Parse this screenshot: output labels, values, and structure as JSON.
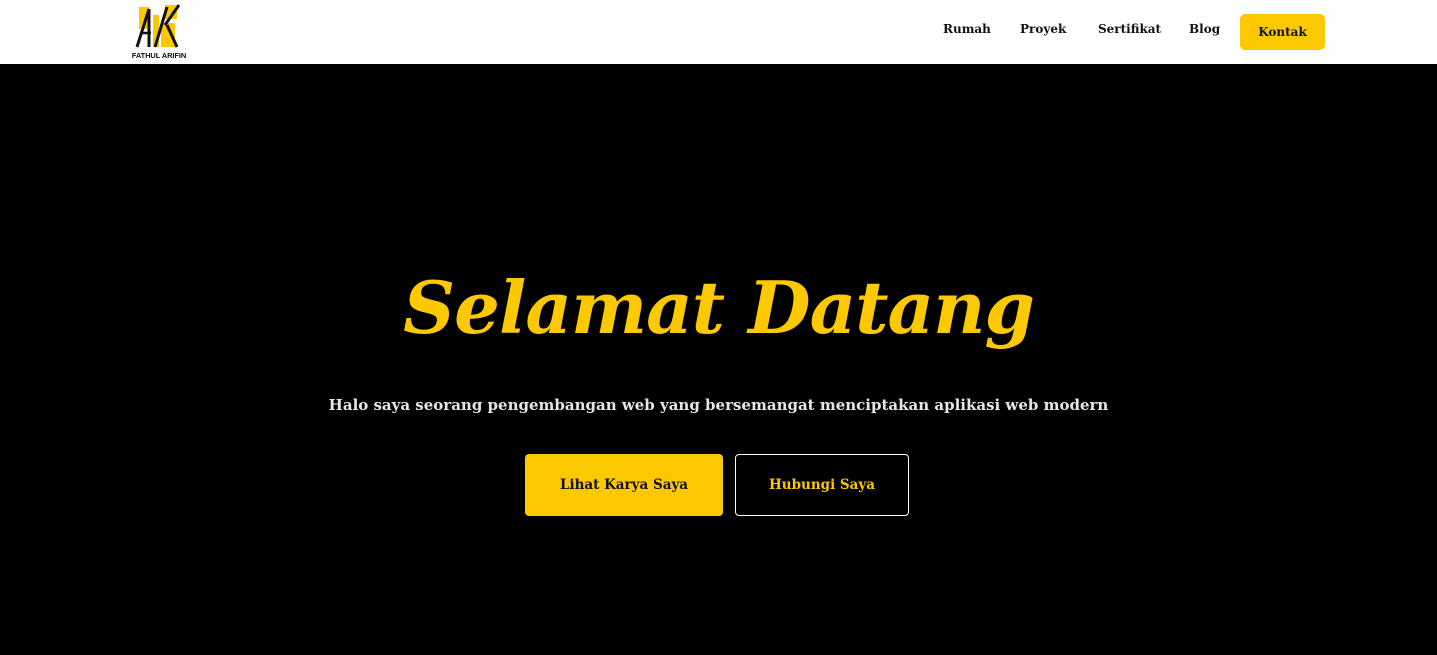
{
  "colors": {
    "accent": "#fcc800",
    "hero_bg": "#000000",
    "nav_bg": "#ffffff",
    "text_dark": "#111111",
    "text_light": "#e6e6e6"
  },
  "brand": {
    "logo_icon": "fa-monogram-logo-icon",
    "name": "FATHUL ARIFIN"
  },
  "nav": {
    "items": [
      {
        "label": "Rumah"
      },
      {
        "label": "Proyek"
      },
      {
        "label": "Sertifikat"
      },
      {
        "label": "Blog"
      }
    ],
    "cta_label": "Kontak"
  },
  "hero": {
    "title": "Selamat Datang",
    "subtitle": "Halo saya seorang pengembangan web yang bersemangat menciptakan aplikasi web modern",
    "primary_button": "Lihat Karya Saya",
    "secondary_button": "Hubungi Saya"
  }
}
